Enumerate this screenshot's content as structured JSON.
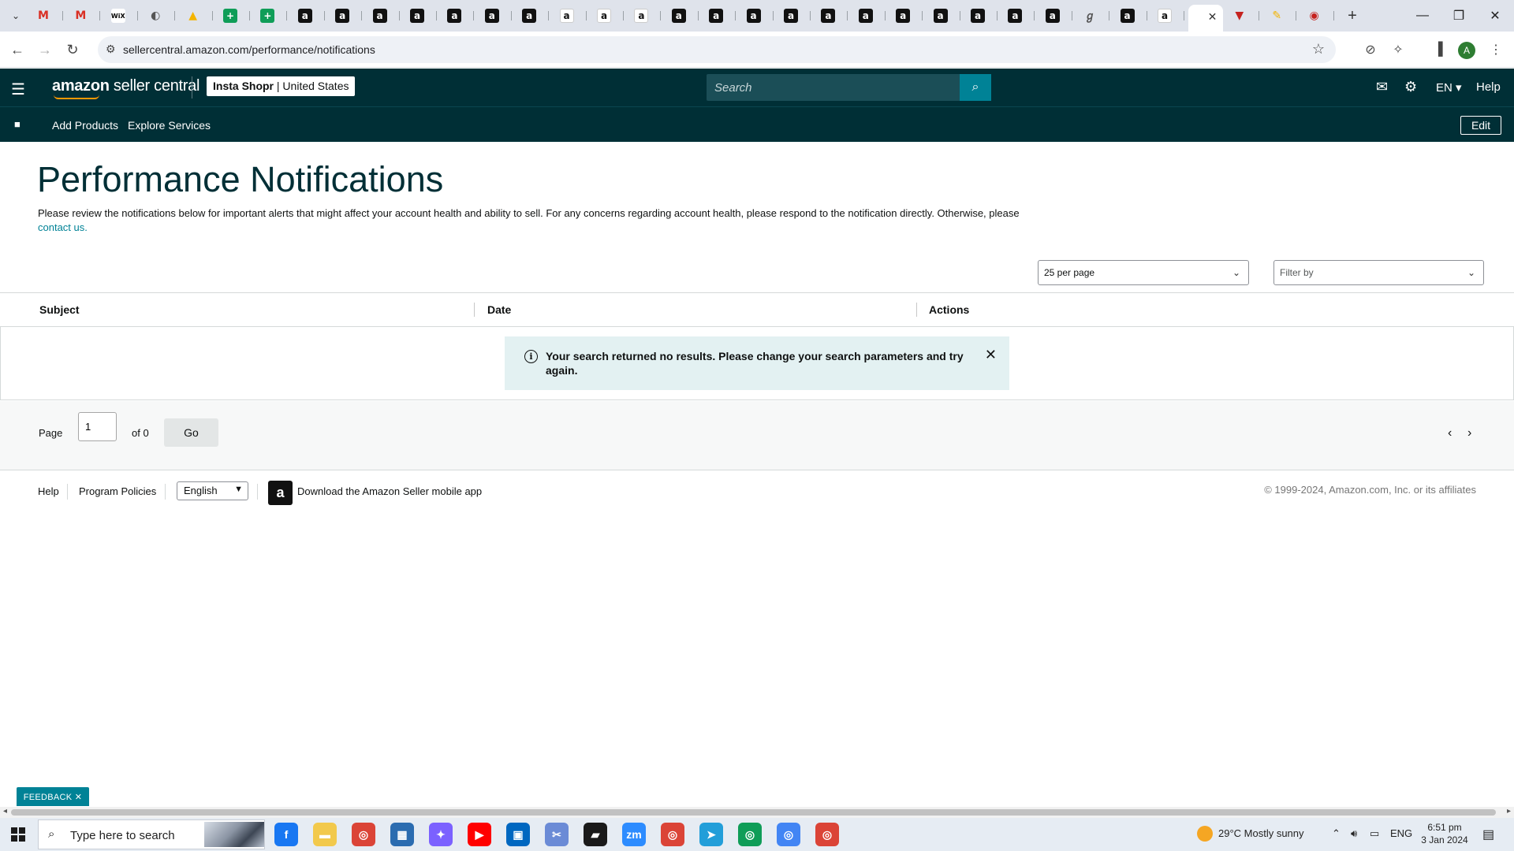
{
  "browser": {
    "tabs": [
      {
        "icon": "gmail-icon",
        "glyph": "M",
        "style": "gm"
      },
      {
        "icon": "gmail-icon",
        "glyph": "M",
        "style": "gm"
      },
      {
        "icon": "wix-icon",
        "glyph": "WiX",
        "style": "wix"
      },
      {
        "icon": "globe-icon",
        "glyph": "◐",
        "style": "globe"
      },
      {
        "icon": "google-drive-icon",
        "glyph": "▲",
        "style": "drive"
      },
      {
        "icon": "sheets-icon",
        "glyph": "+",
        "style": "sheet"
      },
      {
        "icon": "sheets-icon",
        "glyph": "+",
        "style": "sheet"
      },
      {
        "icon": "amazon-icon",
        "glyph": "a",
        "style": "amz"
      },
      {
        "icon": "amazon-icon",
        "glyph": "a",
        "style": "amz"
      },
      {
        "icon": "amazon-icon",
        "glyph": "a",
        "style": "amz"
      },
      {
        "icon": "amazon-icon",
        "glyph": "a",
        "style": "amz"
      },
      {
        "icon": "amazon-icon",
        "glyph": "a",
        "style": "amz"
      },
      {
        "icon": "amazon-icon",
        "glyph": "a",
        "style": "amz"
      },
      {
        "icon": "amazon-icon",
        "glyph": "a",
        "style": "amz"
      },
      {
        "icon": "amazon-smile-icon",
        "glyph": "a",
        "style": "amzw"
      },
      {
        "icon": "amazon-smile-icon",
        "glyph": "a",
        "style": "amzw"
      },
      {
        "icon": "amazon-smile-icon",
        "glyph": "a",
        "style": "amzw"
      },
      {
        "icon": "amazon-icon",
        "glyph": "a",
        "style": "amz"
      },
      {
        "icon": "amazon-icon",
        "glyph": "a",
        "style": "amz"
      },
      {
        "icon": "amazon-icon",
        "glyph": "a",
        "style": "amz"
      },
      {
        "icon": "amazon-icon",
        "glyph": "a",
        "style": "amz"
      },
      {
        "icon": "amazon-icon",
        "glyph": "a",
        "style": "amz"
      },
      {
        "icon": "amazon-icon",
        "glyph": "a",
        "style": "amz"
      },
      {
        "icon": "amazon-icon",
        "glyph": "a",
        "style": "amz"
      },
      {
        "icon": "amazon-icon",
        "glyph": "a",
        "style": "amz"
      },
      {
        "icon": "amazon-icon",
        "glyph": "a",
        "style": "amz"
      },
      {
        "icon": "amazon-icon",
        "glyph": "a",
        "style": "amz"
      },
      {
        "icon": "amazon-icon",
        "glyph": "a",
        "style": "amz"
      },
      {
        "icon": "misc-icon",
        "glyph": "ℊ",
        "style": "misc"
      },
      {
        "icon": "amazon-icon",
        "glyph": "a",
        "style": "amz"
      },
      {
        "icon": "amazon-smile-icon",
        "glyph": "a",
        "style": "amzw"
      },
      {
        "icon": "active-tab-icon",
        "glyph": "",
        "style": "misc",
        "active": true
      },
      {
        "icon": "shield-icon",
        "glyph": "▼",
        "style": "red"
      },
      {
        "icon": "pen-icon",
        "glyph": "✎",
        "style": "drive"
      },
      {
        "icon": "circle-icon",
        "glyph": "◉",
        "style": "red"
      }
    ],
    "url": "sellercentral.amazon.com/performance/notifications"
  },
  "header": {
    "logo_brand": "amazon",
    "logo_suffix": " seller central",
    "store_name": "Insta Shopr",
    "store_region": " | United States",
    "search_placeholder": "Search",
    "language": "EN ▾",
    "help": "Help"
  },
  "subnav": {
    "links": [
      "Add Products",
      "Explore Services"
    ],
    "edit": "Edit"
  },
  "page": {
    "title": "Performance Notifications",
    "description": "Please review the notifications below for important alerts that might affect your account health and ability to sell. For any concerns regarding account health, please respond to the notification directly. Otherwise, please ",
    "contact_link": "contact us.",
    "per_page": "25 per page",
    "filter_placeholder": "Filter by",
    "columns": [
      "Subject",
      "Date",
      "Actions"
    ],
    "alert_message": "Your search returned no results. Please change your search parameters and try again.",
    "pager": {
      "page_label": "Page",
      "page_value": "1",
      "of_label": "of 0",
      "go": "Go"
    }
  },
  "footer": {
    "help": "Help",
    "policies": "Program Policies",
    "language": "English",
    "app_text": "Download the Amazon Seller mobile app",
    "copyright": "© 1999-2024, Amazon.com, Inc. or its affiliates"
  },
  "feedback": "FEEDBACK ✕",
  "taskbar": {
    "search_text": "Type here to search",
    "apps": [
      {
        "name": "facebook-icon",
        "glyph": "f",
        "color": "#1877f2"
      },
      {
        "name": "file-explorer-icon",
        "glyph": "▬",
        "color": "#f2c94c"
      },
      {
        "name": "chrome-icon",
        "glyph": "◎",
        "color": "#db4437"
      },
      {
        "name": "calculator-icon",
        "glyph": "▦",
        "color": "#2b6cb0"
      },
      {
        "name": "copilot-icon",
        "glyph": "✦",
        "color": "#7b61ff"
      },
      {
        "name": "youtube-icon",
        "glyph": "▶",
        "color": "#ff0000"
      },
      {
        "name": "store-icon",
        "glyph": "▣",
        "color": "#0067c0"
      },
      {
        "name": "snipping-icon",
        "glyph": "✂",
        "color": "#6b8bd6"
      },
      {
        "name": "sticky-notes-icon",
        "glyph": "▰",
        "color": "#1a1a1a"
      },
      {
        "name": "zoom-icon",
        "glyph": "zm",
        "color": "#2d8cff"
      },
      {
        "name": "chrome-icon",
        "glyph": "◎",
        "color": "#db4437"
      },
      {
        "name": "telegram-icon",
        "glyph": "➤",
        "color": "#229ed9"
      },
      {
        "name": "chrome-icon",
        "glyph": "◎",
        "color": "#0f9d58"
      },
      {
        "name": "chrome-icon",
        "glyph": "◎",
        "color": "#4285f4"
      },
      {
        "name": "chrome-icon",
        "glyph": "◎",
        "color": "#db4437"
      }
    ],
    "weather": "29°C  Mostly sunny",
    "tray_lang": "ENG",
    "time": "6:51 pm",
    "date": "3 Jan 2024"
  },
  "colors": {
    "header_bg": "#002f36",
    "accent": "#008296",
    "alert_bg": "#e3f1f2"
  }
}
